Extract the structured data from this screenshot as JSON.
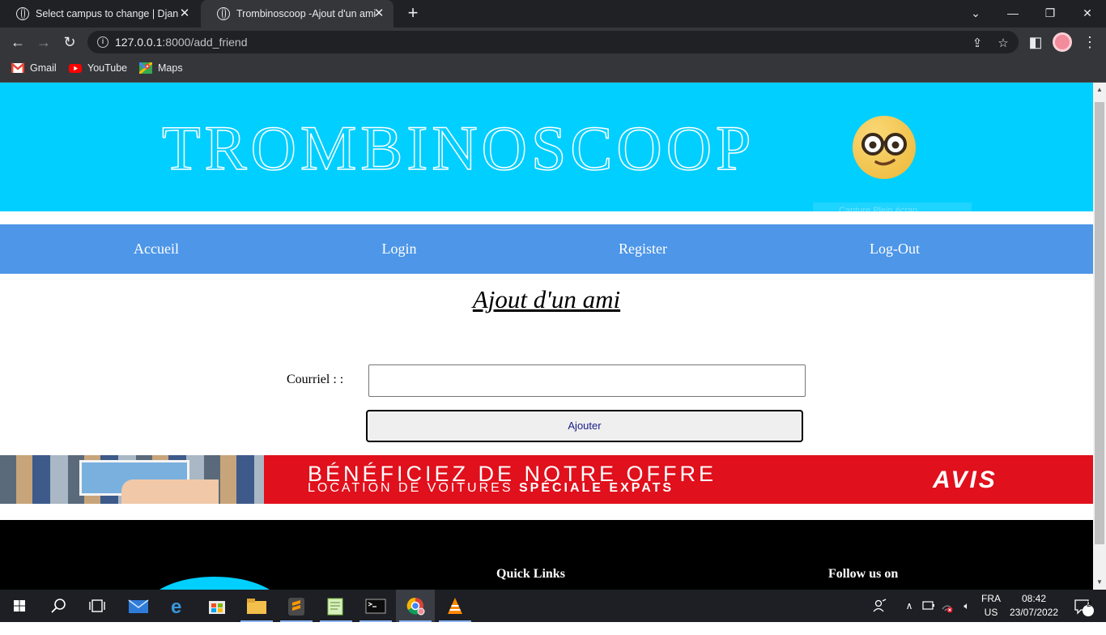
{
  "browser": {
    "tabs": [
      {
        "title": "Select campus to change | Django"
      },
      {
        "title": "Trombinoscoop -Ajout d'un ami"
      }
    ],
    "new_tab_label": "+",
    "url_host": "127.0.0.1",
    "url_rest": ":8000/add_friend",
    "bookmarks": [
      "Gmail",
      "YouTube",
      "Maps"
    ]
  },
  "site": {
    "brand": "TROMBINOSCOOP",
    "emoji": "🤓",
    "capture_ghost": "Capture Plein écran",
    "nav": [
      "Accueil",
      "Login",
      "Register",
      "Log-Out"
    ],
    "page_title": "Ajout d'un ami",
    "form": {
      "email_label": "Courriel : :",
      "email_value": "",
      "submit_label": "Ajouter"
    },
    "ad": {
      "line1": "BÉNÉFICIEZ DE NOTRE OFFRE",
      "line2_regular": "LOCATION DE VOITURES ",
      "line2_bold": "SPÉCIALE EXPATS",
      "logo": "AVIS"
    },
    "footer": {
      "quick_links": "Quick Links",
      "follow_us": "Follow us on"
    }
  },
  "taskbar": {
    "apps": [
      "start-icon",
      "search-icon",
      "task-view-icon",
      "mail-icon",
      "edge-icon",
      "store-icon",
      "file-explorer-icon",
      "sublime-text-icon",
      "notepad-plus-plus-icon",
      "terminal-icon",
      "chrome-icon",
      "vlc-icon"
    ],
    "language_top": "FRA",
    "language_bottom": "US",
    "time": "08:42",
    "date": "23/07/2022",
    "notification_count": "2"
  },
  "colors": {
    "banner": "#00cfff",
    "navbar": "#4d96e8",
    "ad_red": "#e0101c",
    "footer": "#000000"
  }
}
